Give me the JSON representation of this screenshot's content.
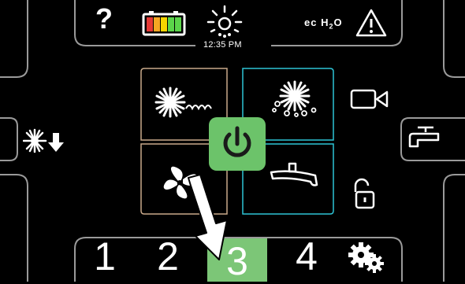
{
  "status_bar": {
    "help_symbol": "?",
    "time": "12:35 PM",
    "echo_label": "ec",
    "echo_h": "H",
    "echo_2": "2",
    "echo_o": "O",
    "battery_colors": [
      "#e53935",
      "#f5a623",
      "#f5d400",
      "#5bd44a",
      "#5bd44a"
    ]
  },
  "controls": {
    "power_color": "#6cc36a",
    "active_quadrant_outline": "#2ec4d6",
    "inactive_quadrant_outline": "#c9a98a"
  },
  "bottom_bar": {
    "items": [
      "1",
      "2",
      "3",
      "4"
    ],
    "active_item": "3",
    "active_color": "#7cc677"
  }
}
